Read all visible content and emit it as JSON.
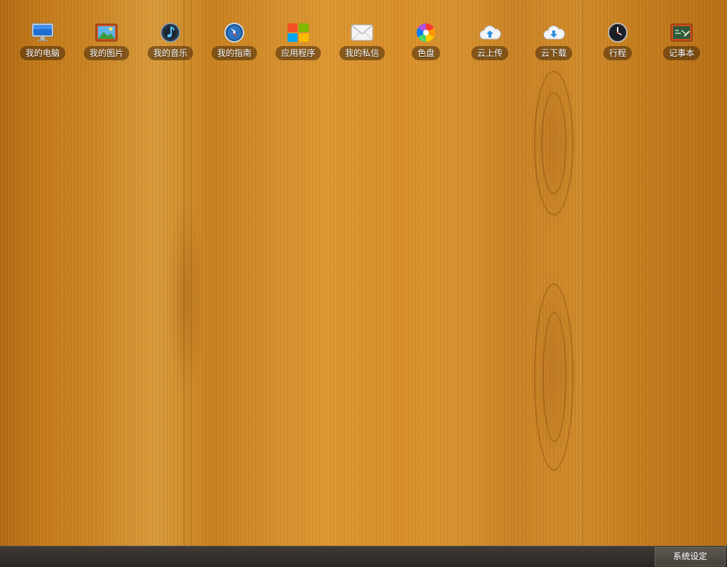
{
  "desktop": {
    "icons": [
      {
        "label": "我的电脑",
        "icon": "computer-icon"
      },
      {
        "label": "我的图片",
        "icon": "pictures-icon"
      },
      {
        "label": "我的音乐",
        "icon": "music-icon"
      },
      {
        "label": "我的指南",
        "icon": "compass-icon"
      },
      {
        "label": "应用程序",
        "icon": "apps-icon"
      },
      {
        "label": "我的私信",
        "icon": "mail-icon"
      },
      {
        "label": "色盘",
        "icon": "color-wheel-icon"
      },
      {
        "label": "云上传",
        "icon": "cloud-upload-icon"
      },
      {
        "label": "云下载",
        "icon": "cloud-download-icon"
      },
      {
        "label": "行程",
        "icon": "clock-icon"
      },
      {
        "label": "记事本",
        "icon": "notepad-icon"
      }
    ]
  },
  "taskbar": {
    "settings_label": "系统设定"
  }
}
